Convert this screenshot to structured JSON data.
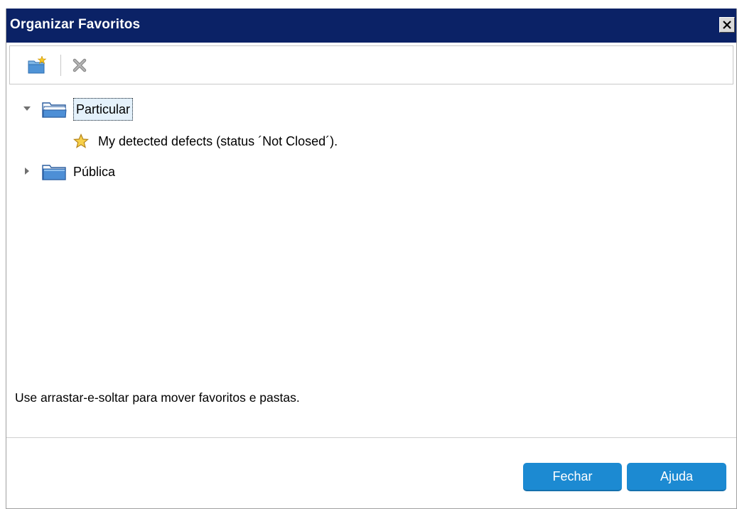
{
  "dialog": {
    "title": "Organizar Favoritos",
    "close_label": "✕"
  },
  "toolbar": {
    "new_folder_icon": "new-folder-icon",
    "delete_icon": "delete-icon"
  },
  "tree": {
    "nodes": [
      {
        "label": "Particular",
        "expanded": true,
        "selected": true,
        "children": [
          {
            "label": "My detected defects (status ´Not Closed´)."
          }
        ]
      },
      {
        "label": "Pública",
        "expanded": false,
        "selected": false
      }
    ]
  },
  "footer": {
    "hint": "Use arrastar-e-soltar para mover favoritos e pastas.",
    "close_button": "Fechar",
    "help_button": "Ajuda"
  },
  "colors": {
    "titlebar": "#0b2266",
    "button": "#1c8ad2",
    "selection": "#e4f1fb"
  }
}
